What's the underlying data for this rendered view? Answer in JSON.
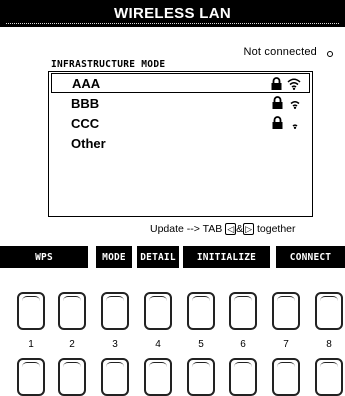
{
  "title": "WIRELESS LAN",
  "status_text": "Not connected",
  "mode_label": "INFRASTRUCTURE MODE",
  "networks": [
    {
      "name": "AAA",
      "locked": true,
      "signal": "strong",
      "selected": true
    },
    {
      "name": "BBB",
      "locked": true,
      "signal": "medium",
      "selected": false
    },
    {
      "name": "CCC",
      "locked": true,
      "signal": "weak",
      "selected": false
    },
    {
      "name": "Other",
      "locked": false,
      "signal": "none",
      "selected": false
    }
  ],
  "hint": {
    "prefix": "Update --> TAB",
    "left_key": "◁",
    "amp": "&",
    "right_key": "▷",
    "suffix": "together"
  },
  "softkeys": {
    "wps": "WPS",
    "mode": "MODE",
    "detail": "DETAIL",
    "initialize": "INITIALIZE",
    "connect": "CONNECT"
  },
  "button_numbers": [
    "1",
    "2",
    "3",
    "4",
    "5",
    "6",
    "7",
    "8"
  ],
  "icons": {
    "lock": "lock-icon",
    "wifi": "wifi-signal-icon",
    "status_dot": "status-dot-icon"
  },
  "colors": {
    "screen_bg": "#ffffff",
    "bar_bg": "#000000",
    "bar_text": "#ffffff"
  }
}
